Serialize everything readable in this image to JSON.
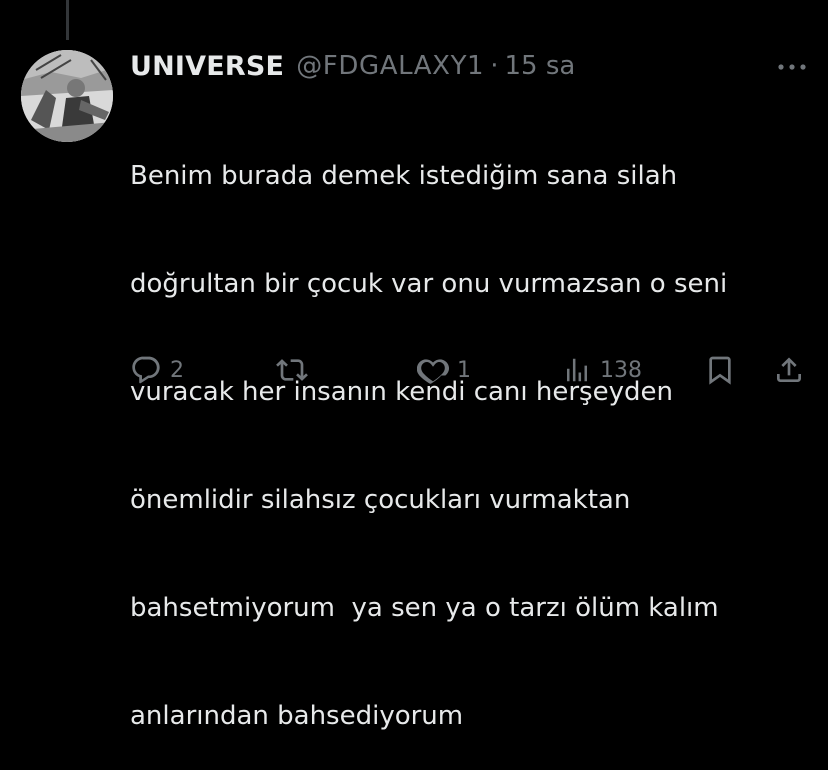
{
  "tweet": {
    "display_name": "UNIVERSE",
    "handle": "@FDGALAXY1",
    "separator": "·",
    "timestamp": "15 sa",
    "text_lines": [
      "Benim burada demek istediğim sana silah",
      "doğrultan bir çocuk var onu vurmazsan o seni",
      "vuracak her insanın kendi canı herşeyden",
      "önemlidir silahsız çocukları vurmaktan",
      "bahsetmiyorum  ya sen ya o tarzı ölüm kalım",
      "anlarından bahsediyorum"
    ]
  },
  "actions": {
    "reply_count": "2",
    "retweet_count": "",
    "like_count": "1",
    "views_count": "138"
  },
  "icons": {
    "more": "more-horizontal-icon",
    "reply": "reply-icon",
    "retweet": "retweet-icon",
    "like": "heart-icon",
    "views": "views-chart-icon",
    "bookmark": "bookmark-icon",
    "share": "share-icon"
  },
  "colors": {
    "background": "#000000",
    "text_primary": "#e7e9ea",
    "text_secondary": "#71767b"
  }
}
